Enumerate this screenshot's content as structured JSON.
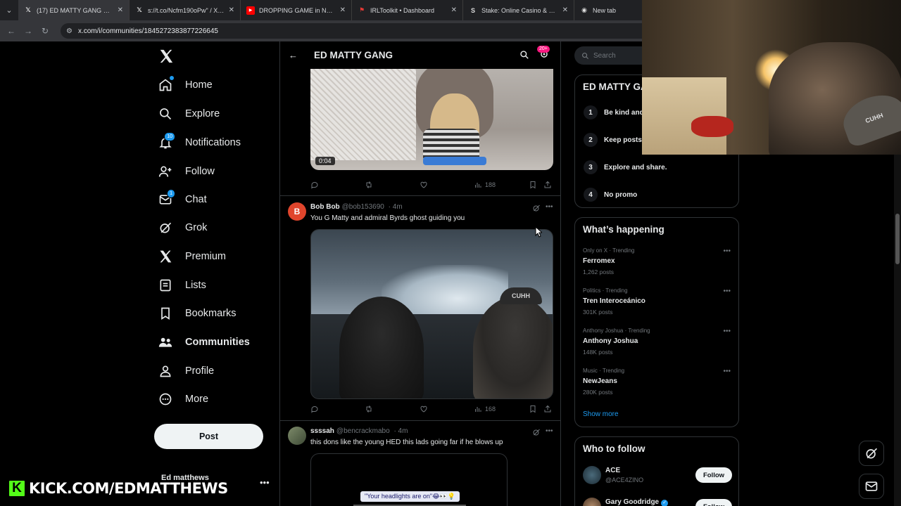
{
  "browser": {
    "tabs": [
      {
        "title": "(17) ED MATTY GANG Commun",
        "icon": "x-logo",
        "active": true
      },
      {
        "title": "s://t.co/Ncfm190oPw\" / X \"(17)",
        "icon": "x-logo",
        "active": false
      },
      {
        "title": "DROPPING GAME in Newcastle",
        "icon": "youtube-icon",
        "active": false
      },
      {
        "title": "IRLToolkit • Dashboard",
        "icon": "irltoolkit-icon",
        "active": false
      },
      {
        "title": "Stake: Online Casino & Sports",
        "icon": "stake-icon",
        "active": false
      },
      {
        "title": "New tab",
        "icon": "chrome-icon",
        "active": false
      }
    ],
    "url": "x.com/i/communities/1845272383877226645"
  },
  "sidebar": {
    "items": [
      {
        "label": "Home",
        "icon": "home-icon"
      },
      {
        "label": "Explore",
        "icon": "search-icon"
      },
      {
        "label": "Notifications",
        "icon": "bell-icon",
        "badge": "10"
      },
      {
        "label": "Follow",
        "icon": "add-person-icon"
      },
      {
        "label": "Chat",
        "icon": "mail-icon",
        "badge": "1"
      },
      {
        "label": "Grok",
        "icon": "grok-icon"
      },
      {
        "label": "Premium",
        "icon": "x-logo"
      },
      {
        "label": "Lists",
        "icon": "list-icon"
      },
      {
        "label": "Bookmarks",
        "icon": "bookmark-icon"
      },
      {
        "label": "Communities",
        "icon": "communities-icon"
      },
      {
        "label": "Profile",
        "icon": "person-icon"
      },
      {
        "label": "More",
        "icon": "more-circle-icon"
      }
    ],
    "post_label": "Post",
    "account_name": "Ed matthews"
  },
  "center": {
    "header_title": "ED MATTY GANG",
    "header_badge": "20+",
    "post1": {
      "duration": "0:04",
      "views": "188"
    },
    "post2": {
      "name": "Bob Bob",
      "handle": "@bob153690",
      "time": "· 4m",
      "avatar_letter": "B",
      "text": "You G Matty and admiral Byrds ghost guiding you",
      "image_cap_text": "CUHH",
      "views": "168"
    },
    "post3": {
      "name": "ssssah",
      "handle": "@bencrackmabo",
      "time": "· 4m",
      "text": "this dons like the young HED this lads going far if he blows up",
      "caption": "\"Your headlights are on\"😂👀💡"
    }
  },
  "right": {
    "search_placeholder": "Search",
    "rules_title": "ED MATTY GA",
    "rules": [
      {
        "num": "1",
        "text": "Be kind and"
      },
      {
        "num": "2",
        "text": "Keep posts"
      },
      {
        "num": "3",
        "text": "Explore and share."
      },
      {
        "num": "4",
        "text": "No promo"
      }
    ],
    "happening_title": "What’s happening",
    "trends": [
      {
        "context": "Only on X · Trending",
        "title": "Ferromex",
        "count": "1,262 posts"
      },
      {
        "context": "Politics · Trending",
        "title": "Tren Interoceánico",
        "count": "301K posts"
      },
      {
        "context": "Anthony Joshua · Trending",
        "title": "Anthony Joshua",
        "count": "148K posts"
      },
      {
        "context": "Music · Trending",
        "title": "NewJeans",
        "count": "280K posts"
      }
    ],
    "show_more": "Show more",
    "who_title": "Who to follow",
    "follow": [
      {
        "name": "ACE",
        "handle": "@ACE4ZINO",
        "button": "Follow"
      },
      {
        "name": "Gary Goodridge",
        "handle": "",
        "button": "Follow"
      }
    ]
  },
  "overlay": {
    "kick_letter": "K",
    "kick_text": "KICK.COM/EDMATTHEWS",
    "cam_cap_text": "CUHH"
  },
  "colors": {
    "accent": "#1d9bf0",
    "kick_green": "#53fc18",
    "background": "#000000"
  }
}
